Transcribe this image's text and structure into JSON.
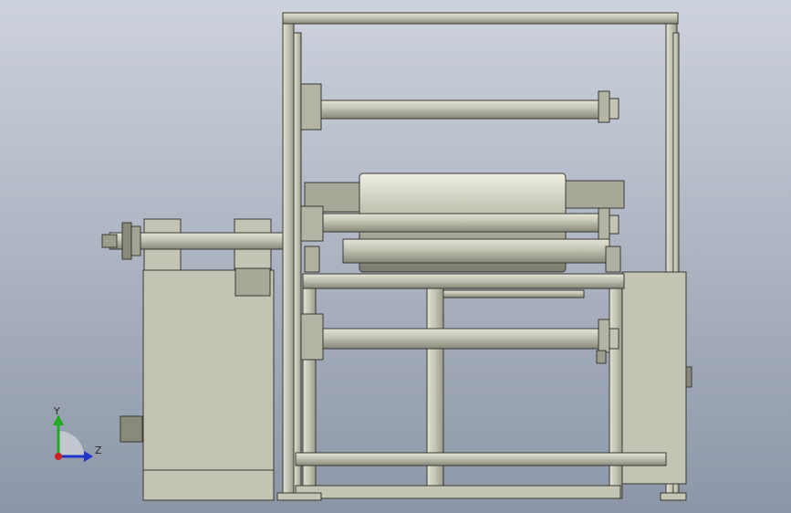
{
  "viewport": {
    "background_top": "#cdd2dc",
    "background_bottom": "#8c96a8",
    "part_fill": "#c4c4b4",
    "part_shade": "#9c9c8c",
    "edge_color": "#3a3a34"
  },
  "triad": {
    "y_label": "Y",
    "z_label": "Z",
    "y_axis_color": "#22aa22",
    "z_axis_color": "#2233cc",
    "x_axis_color": "#cc2222"
  }
}
